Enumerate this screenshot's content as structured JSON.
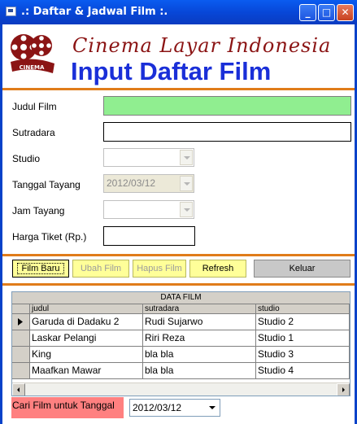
{
  "window": {
    "title": ".: Daftar & Jadwal Film :."
  },
  "header": {
    "brand": "Cinema Layar Indonesia",
    "title": "Input Daftar Film",
    "logo_text": "CINEMA"
  },
  "form": {
    "judul_label": "Judul Film",
    "judul_value": "",
    "sutradara_label": "Sutradara",
    "sutradara_value": "",
    "studio_label": "Studio",
    "studio_value": "",
    "tanggal_label": "Tanggal Tayang",
    "tanggal_value": "2012/03/12",
    "jam_label": "Jam Tayang",
    "jam_value": "",
    "harga_label": "Harga Tiket (Rp.)",
    "harga_value": ""
  },
  "buttons": {
    "film_baru": "Film Baru",
    "ubah_film": "Ubah Film",
    "hapus_film": "Hapus Film",
    "refresh": "Refresh",
    "keluar": "Keluar"
  },
  "grid": {
    "caption": "DATA FILM",
    "columns": [
      "judul",
      "sutradara",
      "studio"
    ],
    "rows": [
      [
        "Garuda di Dadaku 2",
        "Rudi Sujarwo",
        "Studio 2"
      ],
      [
        "Laskar Pelangi",
        "Riri Reza",
        "Studio 1"
      ],
      [
        "King",
        "bla bla",
        "Studio 3"
      ],
      [
        "Maafkan Mawar",
        "bla bla",
        "Studio 4"
      ]
    ]
  },
  "search": {
    "label": "Cari Film untuk Tanggal",
    "value": "2012/03/12"
  },
  "colors": {
    "accent_green": "#90EE90",
    "accent_yellow": "#FFFF99",
    "accent_red": "#FF8080",
    "title_blue": "#1A2FD8",
    "brand_red": "#8B1414",
    "divider_orange": "#E07C1A"
  }
}
